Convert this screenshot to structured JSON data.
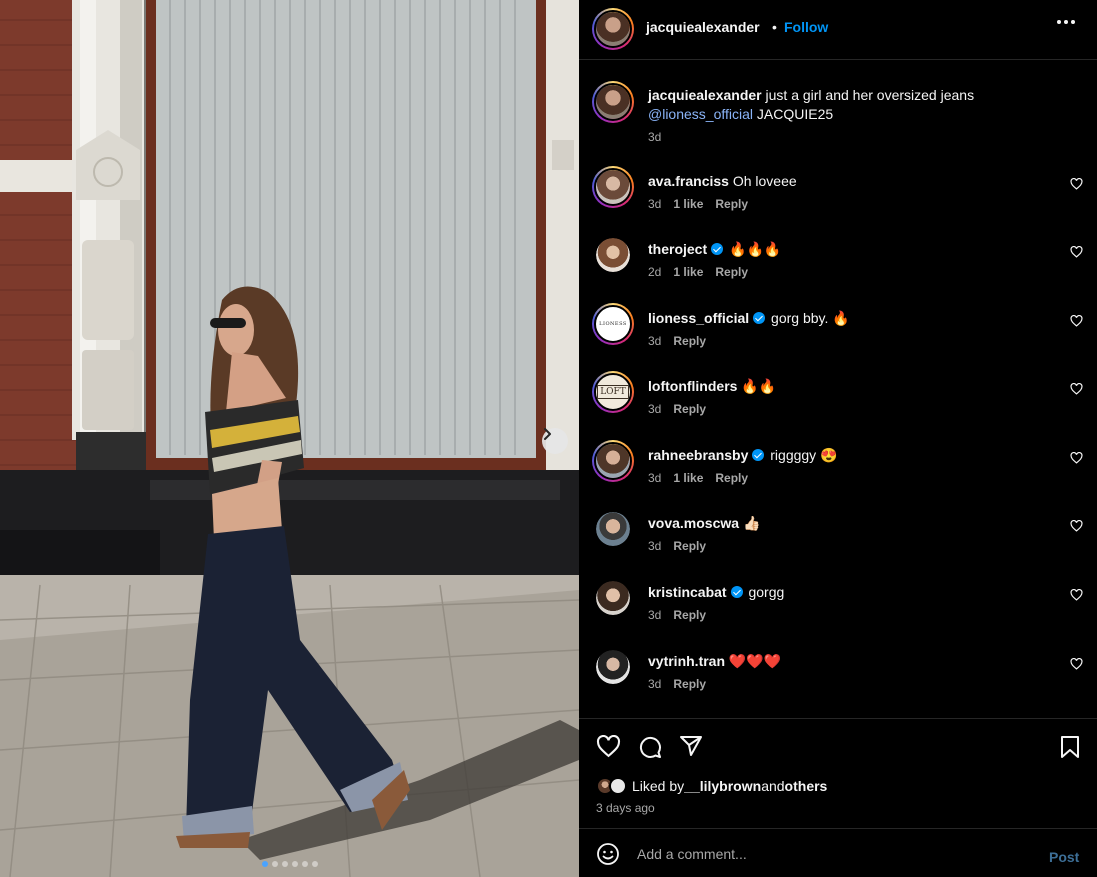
{
  "post": {
    "author": "jacquiealexander",
    "separator": "•",
    "follow_label": "Follow",
    "more_icon": "more-horizontal-icon",
    "caption_user": "jacquiealexander",
    "caption_text": " just a girl and her oversized jeans",
    "caption_mention": "@lioness_official",
    "caption_code": " JACQUIE25",
    "caption_time": "3d"
  },
  "comments": [
    {
      "user": "ava.franciss",
      "verified": false,
      "text": "Oh loveee",
      "time": "3d",
      "likes": "1 like",
      "reply": "Reply"
    },
    {
      "user": "theroject",
      "verified": true,
      "text": "🔥🔥🔥",
      "time": "2d",
      "likes": "1 like",
      "reply": "Reply"
    },
    {
      "user": "lioness_official",
      "verified": true,
      "text": "gorg bby. 🔥",
      "time": "3d",
      "likes": "",
      "reply": "Reply"
    },
    {
      "user": "loftonflinders",
      "verified": false,
      "text": "🔥🔥",
      "time": "3d",
      "likes": "",
      "reply": "Reply"
    },
    {
      "user": "rahneebransby",
      "verified": true,
      "text": "riggggy 😍",
      "time": "3d",
      "likes": "1 like",
      "reply": "Reply"
    },
    {
      "user": "vova.moscwa",
      "verified": false,
      "text": "👍🏻",
      "time": "3d",
      "likes": "",
      "reply": "Reply"
    },
    {
      "user": "kristincabat",
      "verified": true,
      "text": "gorgg",
      "time": "3d",
      "likes": "",
      "reply": "Reply"
    },
    {
      "user": "vytrinh.tran",
      "verified": false,
      "text": "❤️❤️❤️",
      "time": "3d",
      "likes": "",
      "reply": "Reply"
    }
  ],
  "avatar_labels": {
    "lioness": "LIONESS",
    "loft": "LOFT"
  },
  "likes": {
    "prefix": "Liked by ",
    "user": "__lilybrown",
    "middle": " and ",
    "others": "others",
    "time_ago": "3 days ago"
  },
  "add_comment": {
    "placeholder": "Add a comment...",
    "post_label": "Post"
  },
  "carousel": {
    "slide_count": 6,
    "active_index": 0
  },
  "colors": {
    "follow": "#0095f6",
    "verified": "#0095f6",
    "post_disabled": "#3d6f97",
    "background": "#000000"
  }
}
